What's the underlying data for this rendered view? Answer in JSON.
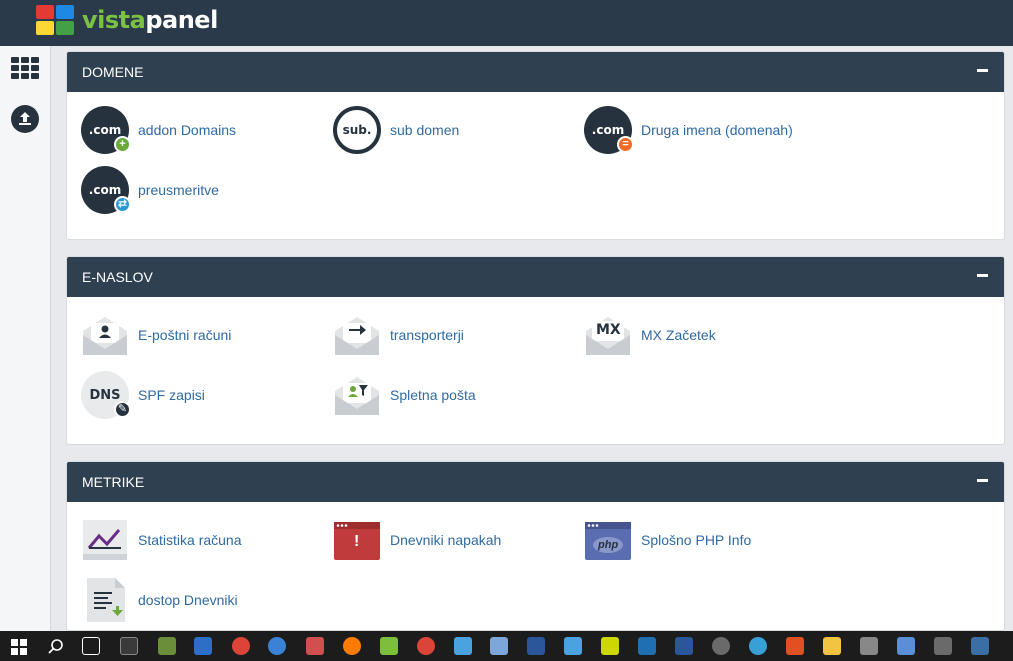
{
  "brand": {
    "vista": "vista",
    "panel": "panel"
  },
  "colors": {
    "header": "#2b3a4a",
    "panel_head": "#2f4050",
    "link": "#2f6aa3"
  },
  "sidebar": {
    "icons": [
      "apps-grid-icon",
      "upload-icon"
    ]
  },
  "sections": [
    {
      "title": "DOMENE",
      "items": [
        {
          "label": "addon Domains",
          "icon": "com-add-icon",
          "icon_text": ".com",
          "badge": "+"
        },
        {
          "label": "sub domen",
          "icon": "subdomain-icon",
          "icon_text": "sub."
        },
        {
          "label": "Druga imena (domenah)",
          "icon": "com-alias-icon",
          "icon_text": ".com",
          "badge": "="
        },
        {
          "label": "preusmeritve",
          "icon": "com-redirect-icon",
          "icon_text": ".com",
          "badge": "⇄"
        }
      ]
    },
    {
      "title": "E-NASLOV",
      "items": [
        {
          "label": "E-poštni računi",
          "icon": "email-accounts-icon"
        },
        {
          "label": "transporterji",
          "icon": "forwarders-icon"
        },
        {
          "label": "MX Začetek",
          "icon": "mx-entry-icon",
          "icon_text": "MX"
        },
        {
          "label": "SPF zapisi",
          "icon": "dns-spf-icon",
          "icon_text": "DNS",
          "badge": "✎"
        },
        {
          "label": "Spletna pošta",
          "icon": "webmail-icon"
        }
      ]
    },
    {
      "title": "METRIKE",
      "items": [
        {
          "label": "Statistika računa",
          "icon": "stats-chart-icon"
        },
        {
          "label": "Dnevniki napakah",
          "icon": "error-log-icon",
          "icon_text": "!"
        },
        {
          "label": "Splošno PHP Info",
          "icon": "php-info-icon",
          "icon_text": "php"
        },
        {
          "label": "dostop Dnevniki",
          "icon": "access-log-icon"
        }
      ]
    }
  ],
  "toggle": "−"
}
